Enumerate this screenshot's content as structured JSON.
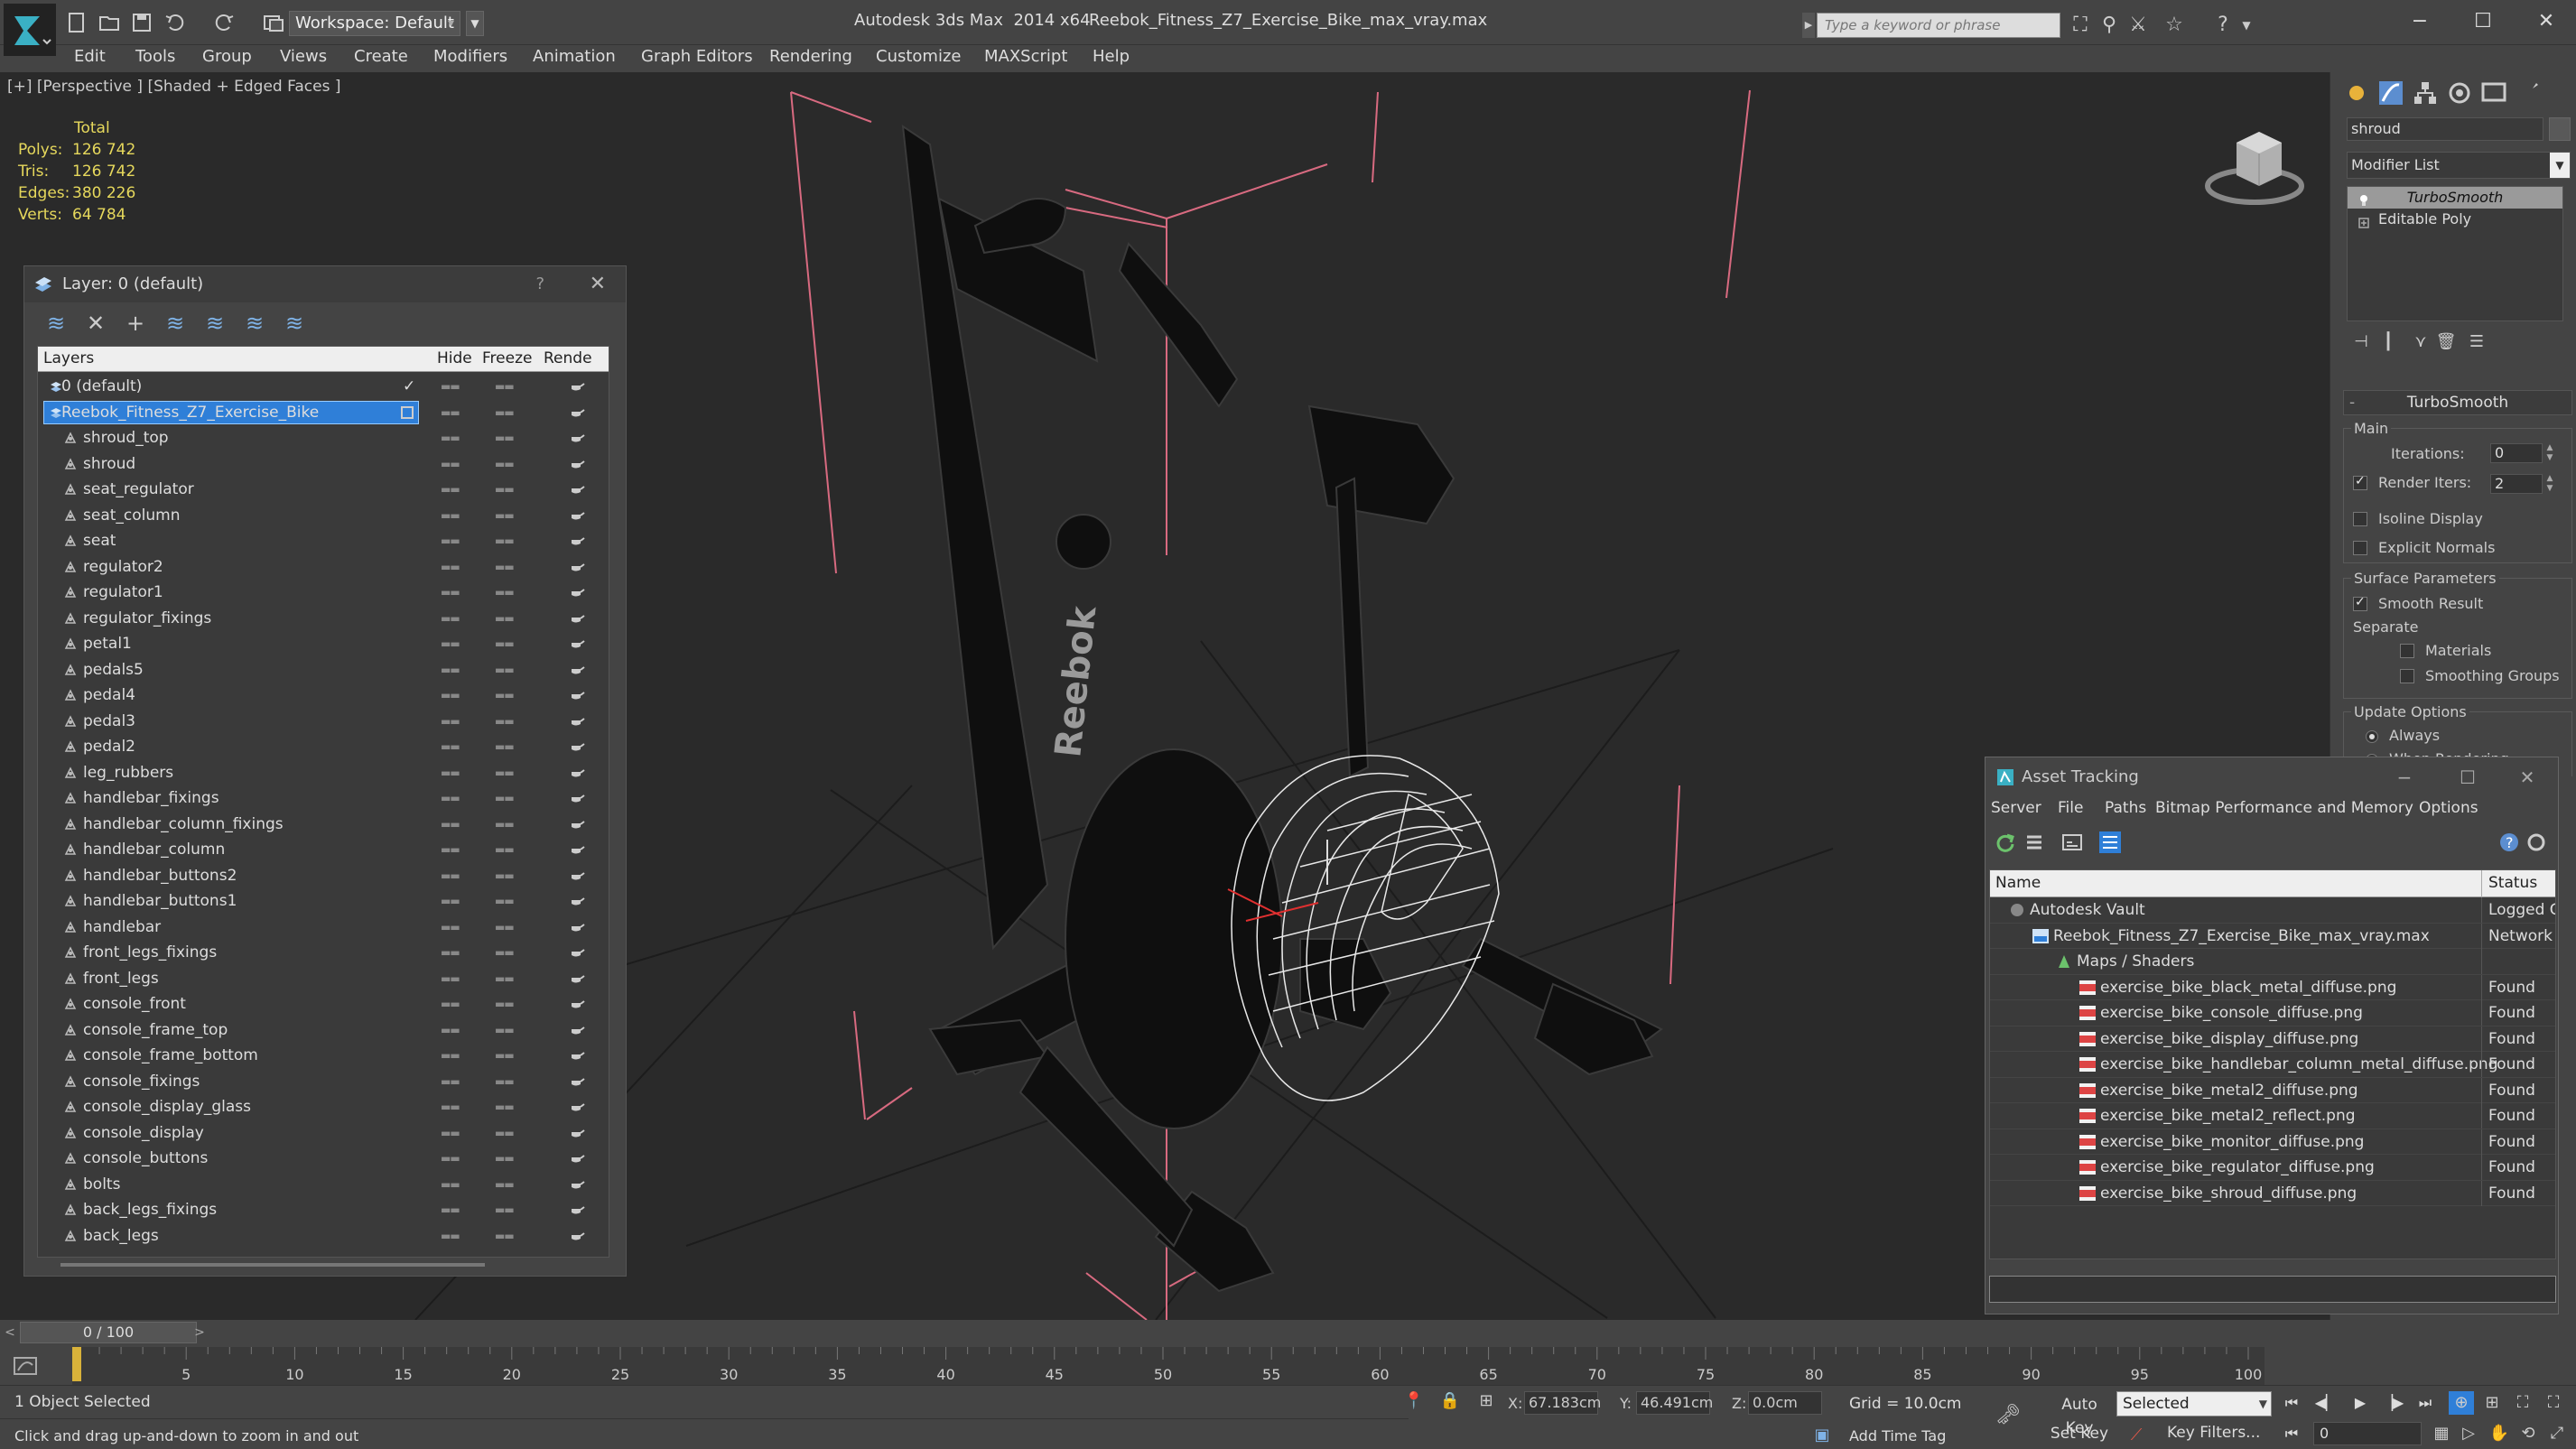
{
  "titlebar": {
    "workspace": "Workspace: Default",
    "app_title": "Autodesk 3ds Max  2014 x64",
    "file_title": "Reebok_Fitness_Z7_Exercise_Bike_max_vray.max",
    "search_placeholder": "Type a keyword or phrase"
  },
  "menu": [
    "Edit",
    "Tools",
    "Group",
    "Views",
    "Create",
    "Modifiers",
    "Animation",
    "Graph Editors",
    "Rendering",
    "Customize",
    "MAXScript",
    "Help"
  ],
  "viewport": {
    "label": "[+] [Perspective ] [Shaded + Edged Faces ]",
    "stats": {
      "header": "Total",
      "rows": [
        {
          "label": "Polys:",
          "value": "126 742"
        },
        {
          "label": "Tris:",
          "value": "126 742"
        },
        {
          "label": "Edges:",
          "value": "380 226"
        },
        {
          "label": "Verts:",
          "value": "64 784"
        }
      ]
    },
    "brand_text": "Reebok"
  },
  "layer_panel": {
    "title": "Layer: 0 (default)",
    "help": "?",
    "columns": {
      "layers": "Layers",
      "hide": "Hide",
      "freeze": "Freeze",
      "render": "Rende"
    },
    "rows": [
      {
        "name": "0 (default)",
        "type": "layer"
      },
      {
        "name": "Reebok_Fitness_Z7_Exercise_Bike",
        "type": "layer"
      },
      {
        "name": "shroud_top",
        "type": "object"
      },
      {
        "name": "shroud",
        "type": "object"
      },
      {
        "name": "seat_regulator",
        "type": "object"
      },
      {
        "name": "seat_column",
        "type": "object"
      },
      {
        "name": "seat",
        "type": "object"
      },
      {
        "name": "regulator2",
        "type": "object"
      },
      {
        "name": "regulator1",
        "type": "object"
      },
      {
        "name": "regulator_fixings",
        "type": "object"
      },
      {
        "name": "petal1",
        "type": "object"
      },
      {
        "name": "pedals5",
        "type": "object"
      },
      {
        "name": "pedal4",
        "type": "object"
      },
      {
        "name": "pedal3",
        "type": "object"
      },
      {
        "name": "pedal2",
        "type": "object"
      },
      {
        "name": "leg_rubbers",
        "type": "object"
      },
      {
        "name": "handlebar_fixings",
        "type": "object"
      },
      {
        "name": "handlebar_column_fixings",
        "type": "object"
      },
      {
        "name": "handlebar_column",
        "type": "object"
      },
      {
        "name": "handlebar_buttons2",
        "type": "object"
      },
      {
        "name": "handlebar_buttons1",
        "type": "object"
      },
      {
        "name": "handlebar",
        "type": "object"
      },
      {
        "name": "front_legs_fixings",
        "type": "object"
      },
      {
        "name": "front_legs",
        "type": "object"
      },
      {
        "name": "console_front",
        "type": "object"
      },
      {
        "name": "console_frame_top",
        "type": "object"
      },
      {
        "name": "console_frame_bottom",
        "type": "object"
      },
      {
        "name": "console_fixings",
        "type": "object"
      },
      {
        "name": "console_display_glass",
        "type": "object"
      },
      {
        "name": "console_display",
        "type": "object"
      },
      {
        "name": "console_buttons",
        "type": "object"
      },
      {
        "name": "bolts",
        "type": "object"
      },
      {
        "name": "back_legs_fixings",
        "type": "object"
      },
      {
        "name": "back_legs",
        "type": "object"
      }
    ],
    "selected_index": 1,
    "active_index": 0
  },
  "command_panel": {
    "object_name": "shroud",
    "modifier_list": "Modifier List",
    "stack": [
      {
        "name": "TurboSmooth",
        "selected": true
      },
      {
        "name": "Editable Poly",
        "selected": false
      }
    ],
    "turbosmooth": {
      "title": "TurboSmooth",
      "main_group": "Main",
      "iterations_label": "Iterations:",
      "iterations": "0",
      "render_iters_label": "Render Iters:",
      "render_iters": "2",
      "render_iters_checked": true,
      "isoline": "Isoline Display",
      "isoline_checked": false,
      "explicit": "Explicit Normals",
      "explicit_checked": false,
      "surface_group": "Surface Parameters",
      "smooth_result": "Smooth Result",
      "smooth_result_checked": true,
      "separate": "Separate",
      "materials": "Materials",
      "materials_checked": false,
      "smoothing_groups": "Smoothing Groups",
      "smoothing_groups_checked": false,
      "update_group": "Update Options",
      "always": "Always",
      "when_rendering": "When Rendering",
      "update_mode": "always"
    }
  },
  "asset_tracking": {
    "title": "Asset Tracking",
    "menu": [
      "Server",
      "File",
      "Paths",
      "Bitmap Performance and Memory",
      "Options"
    ],
    "columns": {
      "name": "Name",
      "status": "Status"
    },
    "rows": [
      {
        "name": "Autodesk Vault",
        "status": "Logged C",
        "level": 0,
        "icon": "vault-icon"
      },
      {
        "name": "Reebok_Fitness_Z7_Exercise_Bike_max_vray.max",
        "status": "Network",
        "level": 1,
        "icon": "max-file-icon"
      },
      {
        "name": "Maps / Shaders",
        "status": "",
        "level": 2,
        "icon": "maps-icon"
      },
      {
        "name": "exercise_bike_black_metal_diffuse.png",
        "status": "Found",
        "level": 3,
        "icon": "png-icon"
      },
      {
        "name": "exercise_bike_console_diffuse.png",
        "status": "Found",
        "level": 3,
        "icon": "png-icon"
      },
      {
        "name": "exercise_bike_display_diffuse.png",
        "status": "Found",
        "level": 3,
        "icon": "png-icon"
      },
      {
        "name": "exercise_bike_handlebar_column_metal_diffuse.png",
        "status": "Found",
        "level": 3,
        "icon": "png-icon"
      },
      {
        "name": "exercise_bike_metal2_diffuse.png",
        "status": "Found",
        "level": 3,
        "icon": "png-icon"
      },
      {
        "name": "exercise_bike_metal2_reflect.png",
        "status": "Found",
        "level": 3,
        "icon": "png-icon"
      },
      {
        "name": "exercise_bike_monitor_diffuse.png",
        "status": "Found",
        "level": 3,
        "icon": "png-icon"
      },
      {
        "name": "exercise_bike_regulator_diffuse.png",
        "status": "Found",
        "level": 3,
        "icon": "png-icon"
      },
      {
        "name": "exercise_bike_shroud_diffuse.png",
        "status": "Found",
        "level": 3,
        "icon": "png-icon"
      }
    ]
  },
  "timeline": {
    "frame_display": "0 / 100",
    "ticks": [
      "5",
      "10",
      "15",
      "20",
      "25",
      "30",
      "35",
      "40",
      "45",
      "50",
      "55",
      "60",
      "65",
      "70",
      "75",
      "80",
      "85",
      "90",
      "95",
      "100"
    ]
  },
  "status": {
    "selection": "1 Object Selected",
    "hint": "Click and drag up-and-down to zoom in and out",
    "x_label": "X:",
    "x": "67.183cm",
    "y_label": "Y:",
    "y": "46.491cm",
    "z_label": "Z:",
    "z": "0.0cm",
    "grid": "Grid = 10.0cm",
    "add_time_tag": "Add Time Tag",
    "auto_key": "Auto Key",
    "set_key": "Set Key",
    "selected_dd": "Selected",
    "key_filters": "Key Filters...",
    "frame": "0"
  }
}
